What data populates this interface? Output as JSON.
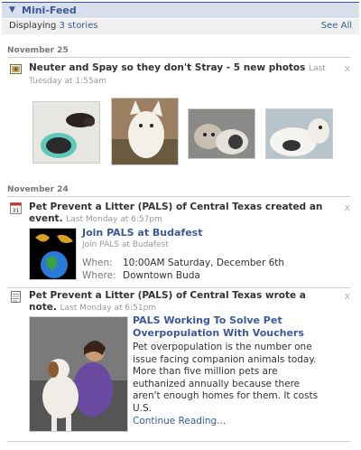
{
  "header": {
    "title": "Mini-Feed"
  },
  "subheader": {
    "prefix": "Displaying ",
    "count_link": "3 stories",
    "see_all": "See All"
  },
  "dates": {
    "first": "November 25",
    "second": "November 24"
  },
  "stories": [
    {
      "title": "Neuter and Spay so they don't Stray - 5 new photos",
      "timestamp": "Last Tuesday at 1:55am",
      "icon": "photo-icon"
    },
    {
      "title": "Pet Prevent a Litter (PALS) of Central Texas created an event.",
      "timestamp": "Last Monday at 6:57pm",
      "icon": "calendar-icon",
      "calendar_day": "31",
      "event": {
        "name": "Join PALS at Budafest",
        "subtitle": "Join PALS at Budafest",
        "when_label": "When:",
        "when_value": "10:00AM Saturday, December 6th",
        "where_label": "Where:",
        "where_value": "Downtown Buda"
      }
    },
    {
      "title": "Pet Prevent a Litter (PALS) of Central Texas wrote a note.",
      "timestamp": "Last Monday at 6:51pm",
      "icon": "note-icon",
      "note": {
        "title": "PALS Working To Solve Pet Overpopulation With Vouchers",
        "body": "Pet overpopulation is the number one issue facing companion animals today. More than five million pets are euthanized annually because there aren't enough homes for them. It costs U.S.",
        "more": "Continue Reading..."
      }
    }
  ],
  "close_glyph": "x"
}
